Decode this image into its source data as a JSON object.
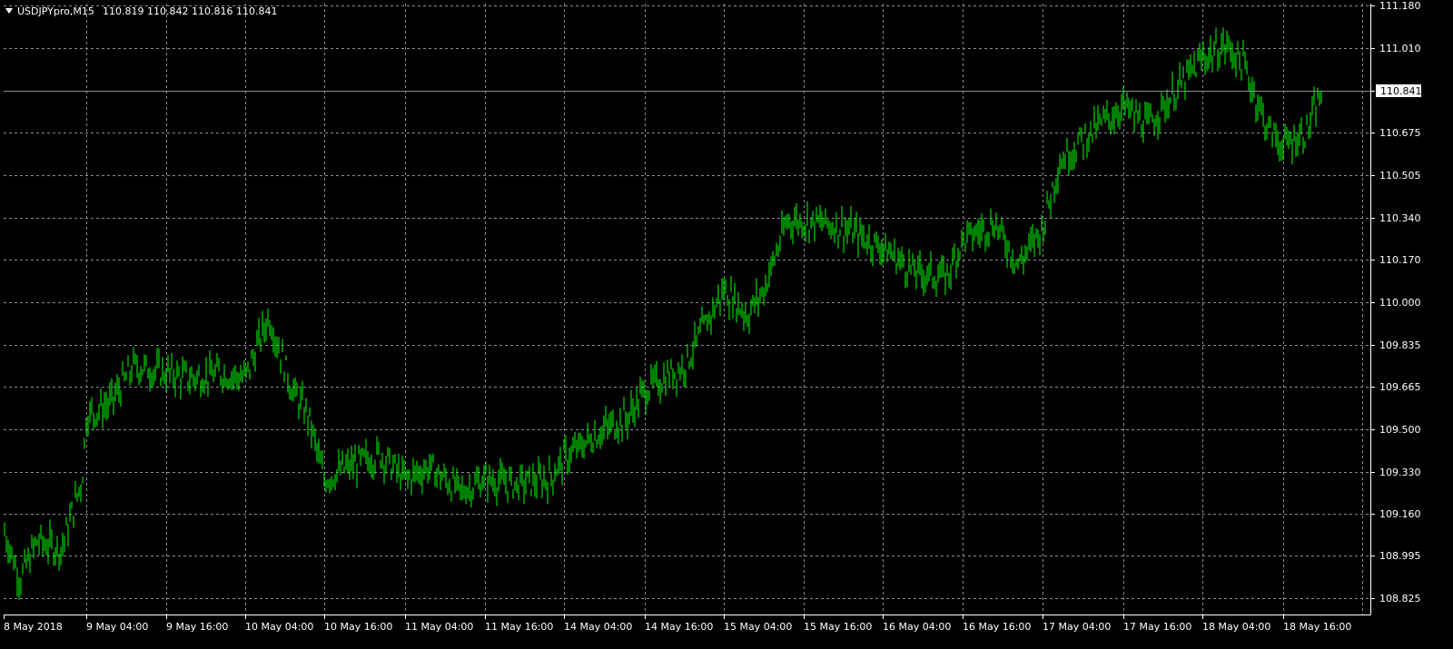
{
  "window": {
    "symbol_timeframe": "USDJPYpro,M15",
    "ohlc": "110.819 110.842 110.816 110.841",
    "dropdown_icon": "triangle-down-icon"
  },
  "colors": {
    "background": "#000000",
    "bars": "#00ff00",
    "grid": "#8a8a96",
    "axis": "#ffffff",
    "bid_line": "#8a8a96",
    "text": "#ffffff"
  },
  "chart_data": {
    "type": "line",
    "chart_style": "ohlc-bars",
    "grid": true,
    "y_axis_position": "right",
    "ylim": [
      108.78,
      111.19
    ],
    "yticks": [
      "111.180",
      "111.010",
      "110.841",
      "110.675",
      "110.505",
      "110.340",
      "110.170",
      "110.000",
      "109.835",
      "109.665",
      "109.500",
      "109.330",
      "109.160",
      "108.995",
      "108.825"
    ],
    "current_price": "110.841",
    "xticks": [
      "8 May 2018",
      "9 May 04:00",
      "9 May 16:00",
      "10 May 04:00",
      "10 May 16:00",
      "11 May 04:00",
      "11 May 16:00",
      "14 May 04:00",
      "14 May 16:00",
      "15 May 04:00",
      "15 May 16:00",
      "16 May 04:00",
      "16 May 16:00",
      "17 May 04:00",
      "17 May 16:00",
      "18 May 04:00",
      "18 May 16:00"
    ],
    "series": [
      {
        "x_index": [
          0,
          1,
          2,
          3,
          4,
          5,
          6,
          7,
          8,
          9,
          10,
          11,
          12,
          13,
          14,
          15,
          16
        ],
        "values": [
          109.1,
          109.55,
          109.72,
          109.7,
          109.95,
          109.3,
          109.35,
          109.3,
          109.3,
          109.48,
          109.65,
          110.05,
          110.33,
          110.3,
          110.22,
          110.1,
          110.32,
          110.55,
          110.78,
          110.85,
          110.97,
          111.05,
          110.84
        ]
      }
    ],
    "path_points": [
      [
        0,
        109.1
      ],
      [
        0.2,
        108.9
      ],
      [
        0.4,
        109.05
      ],
      [
        0.7,
        109.02
      ],
      [
        0.95,
        109.3
      ],
      [
        1.0,
        109.55
      ],
      [
        1.3,
        109.6
      ],
      [
        1.6,
        109.75
      ],
      [
        2.0,
        109.72
      ],
      [
        2.3,
        109.7
      ],
      [
        2.7,
        109.72
      ],
      [
        3.0,
        109.7
      ],
      [
        3.3,
        109.95
      ],
      [
        3.6,
        109.65
      ],
      [
        3.8,
        109.55
      ],
      [
        4.0,
        109.3
      ],
      [
        4.3,
        109.35
      ],
      [
        4.7,
        109.4
      ],
      [
        5.0,
        109.3
      ],
      [
        5.3,
        109.35
      ],
      [
        5.7,
        109.25
      ],
      [
        6.0,
        109.3
      ],
      [
        6.4,
        109.28
      ],
      [
        6.8,
        109.3
      ],
      [
        7.0,
        109.38
      ],
      [
        7.4,
        109.48
      ],
      [
        7.8,
        109.55
      ],
      [
        8.0,
        109.65
      ],
      [
        8.5,
        109.75
      ],
      [
        9.0,
        110.05
      ],
      [
        9.3,
        109.95
      ],
      [
        9.5,
        110.05
      ],
      [
        9.8,
        110.33
      ],
      [
        10.2,
        110.32
      ],
      [
        10.5,
        110.3
      ],
      [
        11.0,
        110.22
      ],
      [
        11.4,
        110.12
      ],
      [
        11.8,
        110.1
      ],
      [
        12.0,
        110.25
      ],
      [
        12.4,
        110.32
      ],
      [
        12.7,
        110.15
      ],
      [
        13.0,
        110.3
      ],
      [
        13.2,
        110.55
      ],
      [
        13.5,
        110.65
      ],
      [
        14.0,
        110.78
      ],
      [
        14.3,
        110.7
      ],
      [
        14.7,
        110.85
      ],
      [
        15.0,
        110.97
      ],
      [
        15.3,
        111.02
      ],
      [
        15.5,
        110.95
      ],
      [
        15.8,
        110.7
      ],
      [
        16.0,
        110.62
      ],
      [
        16.3,
        110.68
      ],
      [
        16.5,
        110.84
      ]
    ]
  }
}
